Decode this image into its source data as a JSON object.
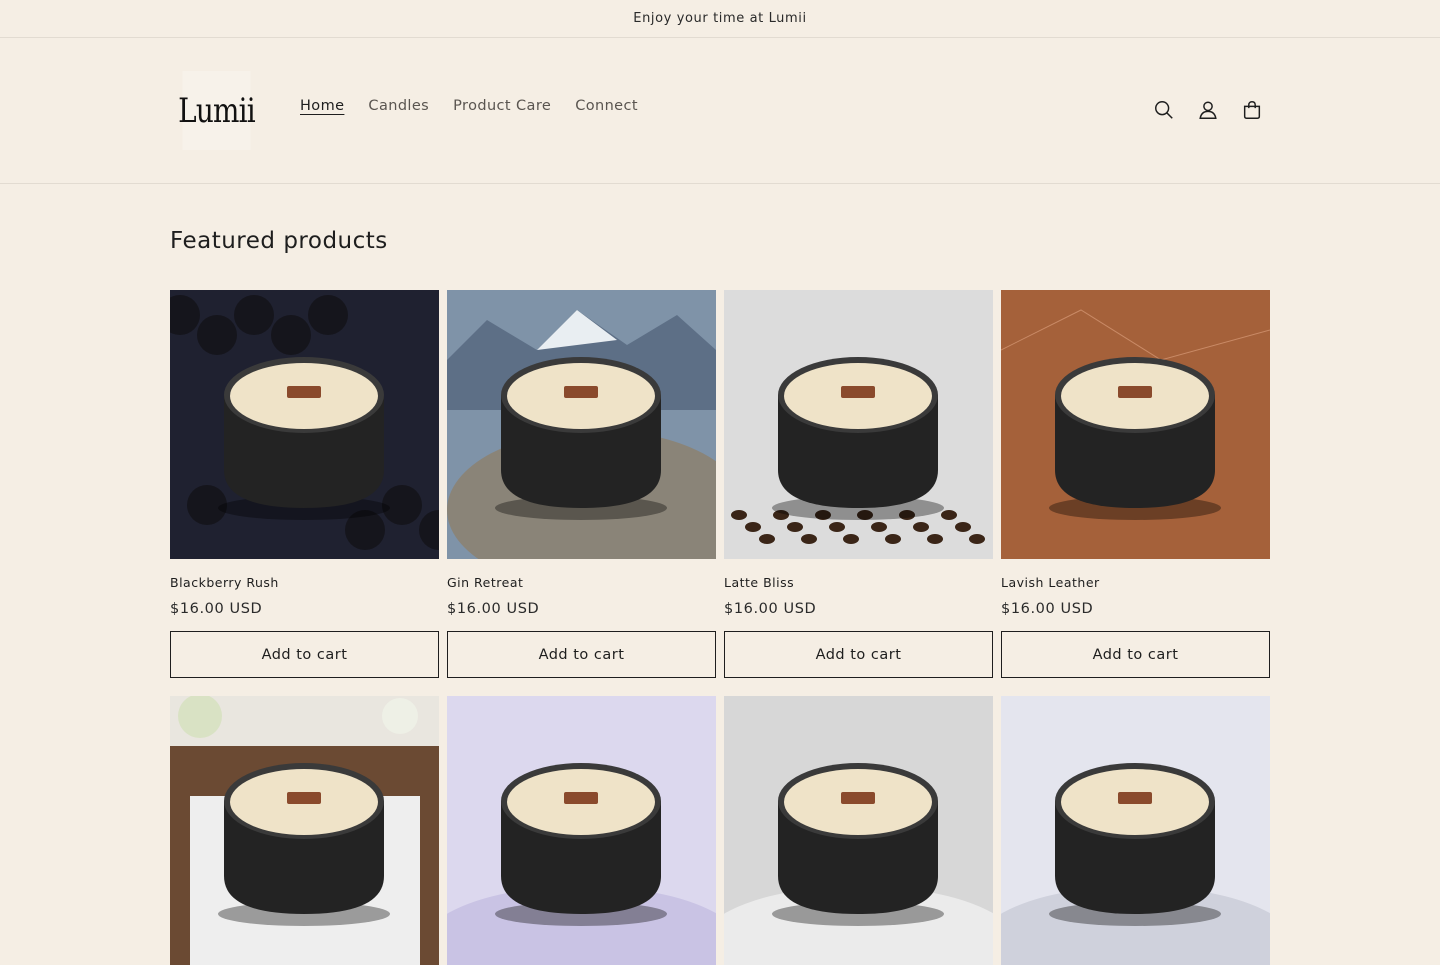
{
  "announcement": {
    "text": "Enjoy your time at Lumii"
  },
  "header": {
    "logo_text": "Lumii",
    "nav": [
      {
        "label": "Home",
        "active": true
      },
      {
        "label": "Candles",
        "active": false
      },
      {
        "label": "Product Care",
        "active": false
      },
      {
        "label": "Connect",
        "active": false
      }
    ],
    "icons": [
      "search-icon",
      "account-icon",
      "cart-icon"
    ]
  },
  "featured": {
    "title": "Featured products",
    "products": [
      {
        "name": "Blackberry Rush",
        "price": "$16.00 USD",
        "button": "Add to cart",
        "backdrop": "#1f2130",
        "accent": "#2c2e3c"
      },
      {
        "name": "Gin Retreat",
        "price": "$16.00 USD",
        "button": "Add to cart",
        "backdrop": "#7f93a8",
        "accent": "#8a8478"
      },
      {
        "name": "Latte Bliss",
        "price": "$16.00 USD",
        "button": "Add to cart",
        "backdrop": "#dcdcdc",
        "accent": "#3a2517"
      },
      {
        "name": "Lavish Leather",
        "price": "$16.00 USD",
        "button": "Add to cart",
        "backdrop": "#a5613a",
        "accent": "#8c4d2b"
      },
      {
        "name": "",
        "price": "",
        "button": "",
        "backdrop": "#e9e6df",
        "accent": "#6d4c35"
      },
      {
        "name": "",
        "price": "",
        "button": "",
        "backdrop": "#dcd8ee",
        "accent": "#c9c3e4"
      },
      {
        "name": "",
        "price": "",
        "button": "",
        "backdrop": "#d7d7d7",
        "accent": "#ebebeb"
      },
      {
        "name": "",
        "price": "",
        "button": "",
        "backdrop": "#e4e5ee",
        "accent": "#cfd1dc"
      }
    ]
  },
  "colors": {
    "page_bg": "#f5eee4",
    "text": "#1e1e1e",
    "border": "#e2dbd1"
  }
}
